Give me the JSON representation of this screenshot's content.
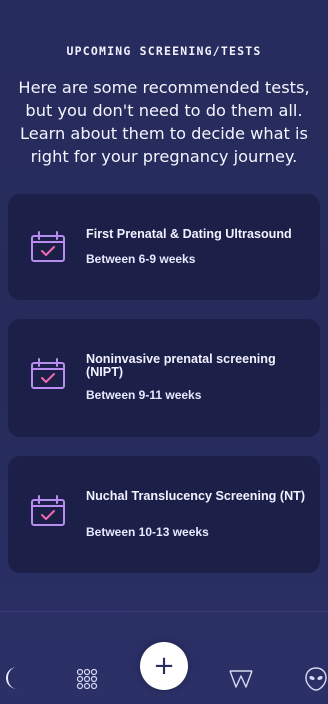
{
  "header": {
    "title": "UPCOMING SCREENING/TESTS",
    "intro": "Here are some recommended tests, but you don't need to do them all. Learn about them to decide what is right for your pregnancy journey."
  },
  "tests": [
    {
      "title": "First Prenatal & Dating Ultrasound",
      "timing": "Between 6-9 weeks",
      "icon": "calendar-check-icon"
    },
    {
      "title": "Noninvasive prenatal screening (NIPT)",
      "timing": "Between 9-11 weeks",
      "icon": "calendar-check-icon"
    },
    {
      "title": "Nuchal Translucency Screening (NT)",
      "timing": "Between 10-13 weeks",
      "icon": "calendar-check-icon"
    }
  ],
  "nav": {
    "items": [
      "moon-icon",
      "grid-icon",
      "plus-icon",
      "w-logo-icon",
      "alien-icon"
    ],
    "add_symbol": "+"
  },
  "colors": {
    "background": "#272c5e",
    "card": "#1c1f48",
    "icon_accent": "#b98cf0",
    "icon_check": "#f06ab0",
    "moon": "#eeeeff"
  }
}
